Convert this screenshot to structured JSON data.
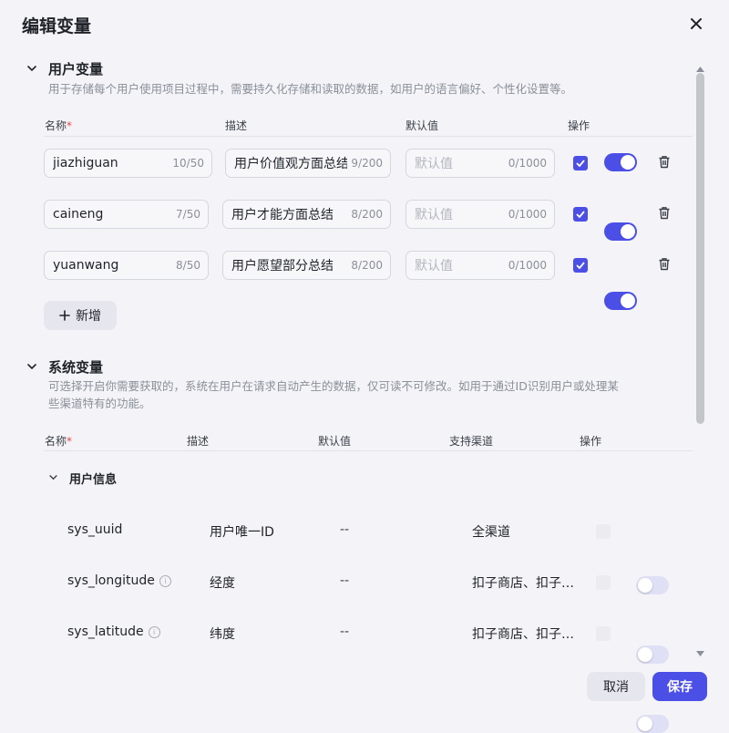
{
  "dialog": {
    "title": "编辑变量"
  },
  "user_vars": {
    "title": "用户变量",
    "description": "用于存储每个用户使用项目过程中，需要持久化存储和读取的数据，如用户的语言偏好、个性化设置等。",
    "headers": {
      "name": "名称",
      "required_mark": "*",
      "desc": "描述",
      "default": "默认值",
      "action": "操作"
    },
    "rows": [
      {
        "name": "jiazhiguan",
        "name_count": "10/50",
        "desc": "用户价值观方面总结",
        "desc_count": "9/200",
        "default_placeholder": "默认值",
        "default_count": "0/1000",
        "checked": true,
        "enabled": true
      },
      {
        "name": "caineng",
        "name_count": "7/50",
        "desc": "用户才能方面总结",
        "desc_count": "8/200",
        "default_placeholder": "默认值",
        "default_count": "0/1000",
        "checked": true,
        "enabled": true
      },
      {
        "name": "yuanwang",
        "name_count": "8/50",
        "desc": "用户愿望部分总结",
        "desc_count": "8/200",
        "default_placeholder": "默认值",
        "default_count": "0/1000",
        "checked": true,
        "enabled": true
      }
    ],
    "add_label": "新增"
  },
  "sys_vars": {
    "title": "系统变量",
    "description_line1": "可选择开启你需要获取的，系统在用户在请求自动产生的数据，仅可读不可修改。如用于通过ID识别用户或处理某",
    "description_line2": "些渠道特有的功能。",
    "headers": {
      "name": "名称",
      "required_mark": "*",
      "desc": "描述",
      "default": "默认值",
      "channel": "支持渠道",
      "action": "操作"
    },
    "group_title": "用户信息",
    "rows": [
      {
        "name": "sys_uuid",
        "desc": "用户唯一ID",
        "default": "--",
        "channel": "全渠道",
        "has_info": false,
        "enabled": false
      },
      {
        "name": "sys_longitude",
        "desc": "经度",
        "default": "--",
        "channel": "扣子商店、扣子…",
        "has_info": true,
        "enabled": false
      },
      {
        "name": "sys_latitude",
        "desc": "纬度",
        "default": "--",
        "channel": "扣子商店、扣子…",
        "has_info": true,
        "enabled": false
      }
    ]
  },
  "footer": {
    "cancel_label": "取消",
    "save_label": "保存"
  },
  "colors": {
    "accent": "#4b4fe6",
    "required": "#e5484d"
  }
}
